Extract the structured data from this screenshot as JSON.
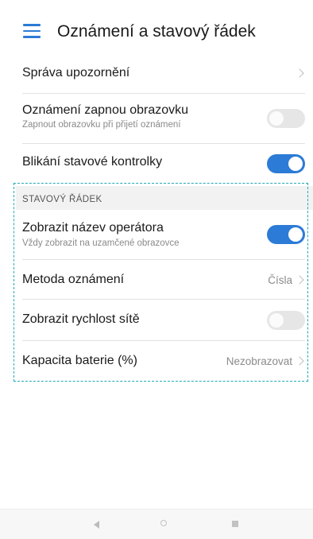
{
  "header": {
    "title": "Oznámení a stavový řádek",
    "menu_icon": "hamburger-menu-icon"
  },
  "settings": {
    "manage_notifications": {
      "label": "Správa upozornění"
    },
    "wake_screen": {
      "label": "Oznámení zapnou obrazovku",
      "sublabel": "Zapnout obrazovku při přijetí oznámení",
      "enabled": false
    },
    "blink_led": {
      "label": "Blikání stavové kontrolky",
      "enabled": true
    }
  },
  "status_bar_section": {
    "title": "STAVOVÝ ŘÁDEK",
    "show_carrier": {
      "label": "Zobrazit název operátora",
      "sublabel": "Vždy zobrazit na uzamčené obrazovce",
      "enabled": true
    },
    "notification_method": {
      "label": "Metoda oznámení",
      "value": "Čísla"
    },
    "network_speed": {
      "label": "Zobrazit rychlost sítě",
      "enabled": false
    },
    "battery_percent": {
      "label": "Kapacita baterie (%)",
      "value": "Nezobrazovat"
    }
  },
  "colors": {
    "accent": "#2c7bd6",
    "highlight_dash": "#21a9b8",
    "toggle_off": "#e6e6e6"
  },
  "navbar": {
    "icons": [
      "back-icon",
      "home-icon",
      "recent-apps-icon"
    ]
  }
}
